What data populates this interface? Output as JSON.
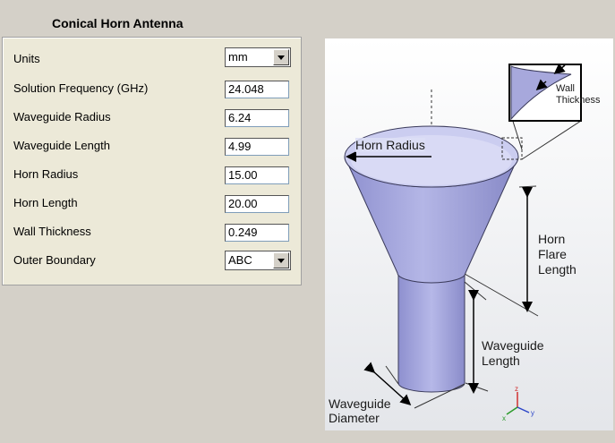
{
  "title": "Conical Horn Antenna",
  "fields": {
    "units": {
      "label": "Units",
      "value": "mm"
    },
    "solution_frequency": {
      "label": "Solution Frequency (GHz)",
      "value": "24.048"
    },
    "waveguide_radius": {
      "label": "Waveguide Radius",
      "value": "6.24"
    },
    "waveguide_length": {
      "label": "Waveguide Length",
      "value": "4.99"
    },
    "horn_radius": {
      "label": "Horn Radius",
      "value": "15.00"
    },
    "horn_length": {
      "label": "Horn Length",
      "value": "20.00"
    },
    "wall_thickness": {
      "label": "Wall Thickness",
      "value": "0.249"
    },
    "outer_boundary": {
      "label": "Outer Boundary",
      "value": "ABC"
    }
  },
  "diagram": {
    "horn_radius": "Horn Radius",
    "wall": "Wall",
    "thickness": "Thickness",
    "horn_flare_1": "Horn",
    "horn_flare_2": "Flare",
    "horn_flare_3": "Length",
    "wg_length_1": "Waveguide",
    "wg_length_2": "Length",
    "wg_diam_1": "Waveguide",
    "wg_diam_2": "Diameter",
    "axis_z": "z",
    "axis_y": "y",
    "axis_x": "x",
    "colors": {
      "body": "#a7a8dc",
      "inner": "#c9cbee",
      "edge": "#3a3a5a"
    }
  }
}
